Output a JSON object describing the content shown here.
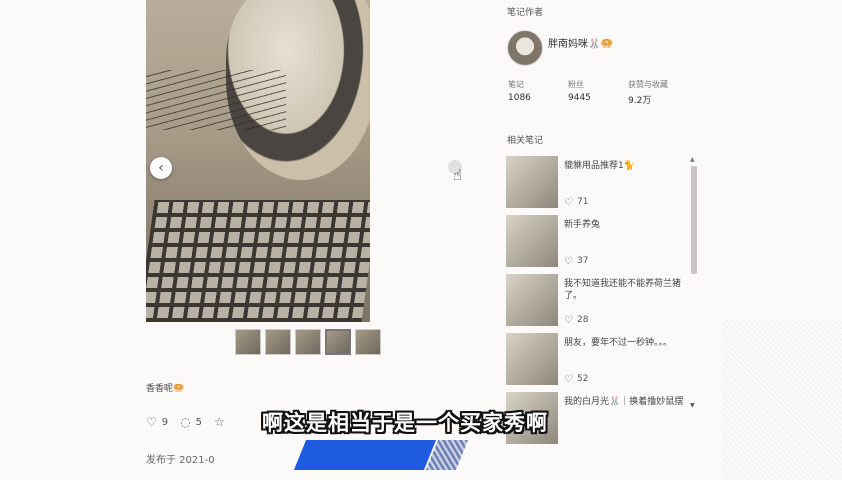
{
  "note": {
    "text": "香香呢🥯",
    "likes": "9",
    "comments": "5",
    "published": "发布于 2021-0"
  },
  "author": {
    "section_title": "笔记作者",
    "name": "胖南妈咪🐰🥯",
    "stats": [
      {
        "label": "笔记",
        "value": "1086"
      },
      {
        "label": "粉丝",
        "value": "9445"
      },
      {
        "label": "获赞与收藏",
        "value": "9.2万"
      }
    ]
  },
  "related": {
    "section_title": "相关笔记",
    "items": [
      {
        "title": "貔貅用品推荐1🐈",
        "likes": "71"
      },
      {
        "title": "新手养兔",
        "likes": "37"
      },
      {
        "title": "我不知道我还能不能养荷兰猪了。",
        "likes": "28"
      },
      {
        "title": "朋友，要年不过一秒钟。。。",
        "likes": "52"
      },
      {
        "title": "我的白月光🐰｜换着撸妙鼠摆",
        "likes": ""
      }
    ]
  },
  "subtitle": "啊这是相当于是一个买家秀啊",
  "icons": {
    "prev": "chevron-left-icon",
    "like": "heart-icon",
    "comment": "comment-icon",
    "collect": "star-icon",
    "cursor": "hand-cursor-icon"
  }
}
